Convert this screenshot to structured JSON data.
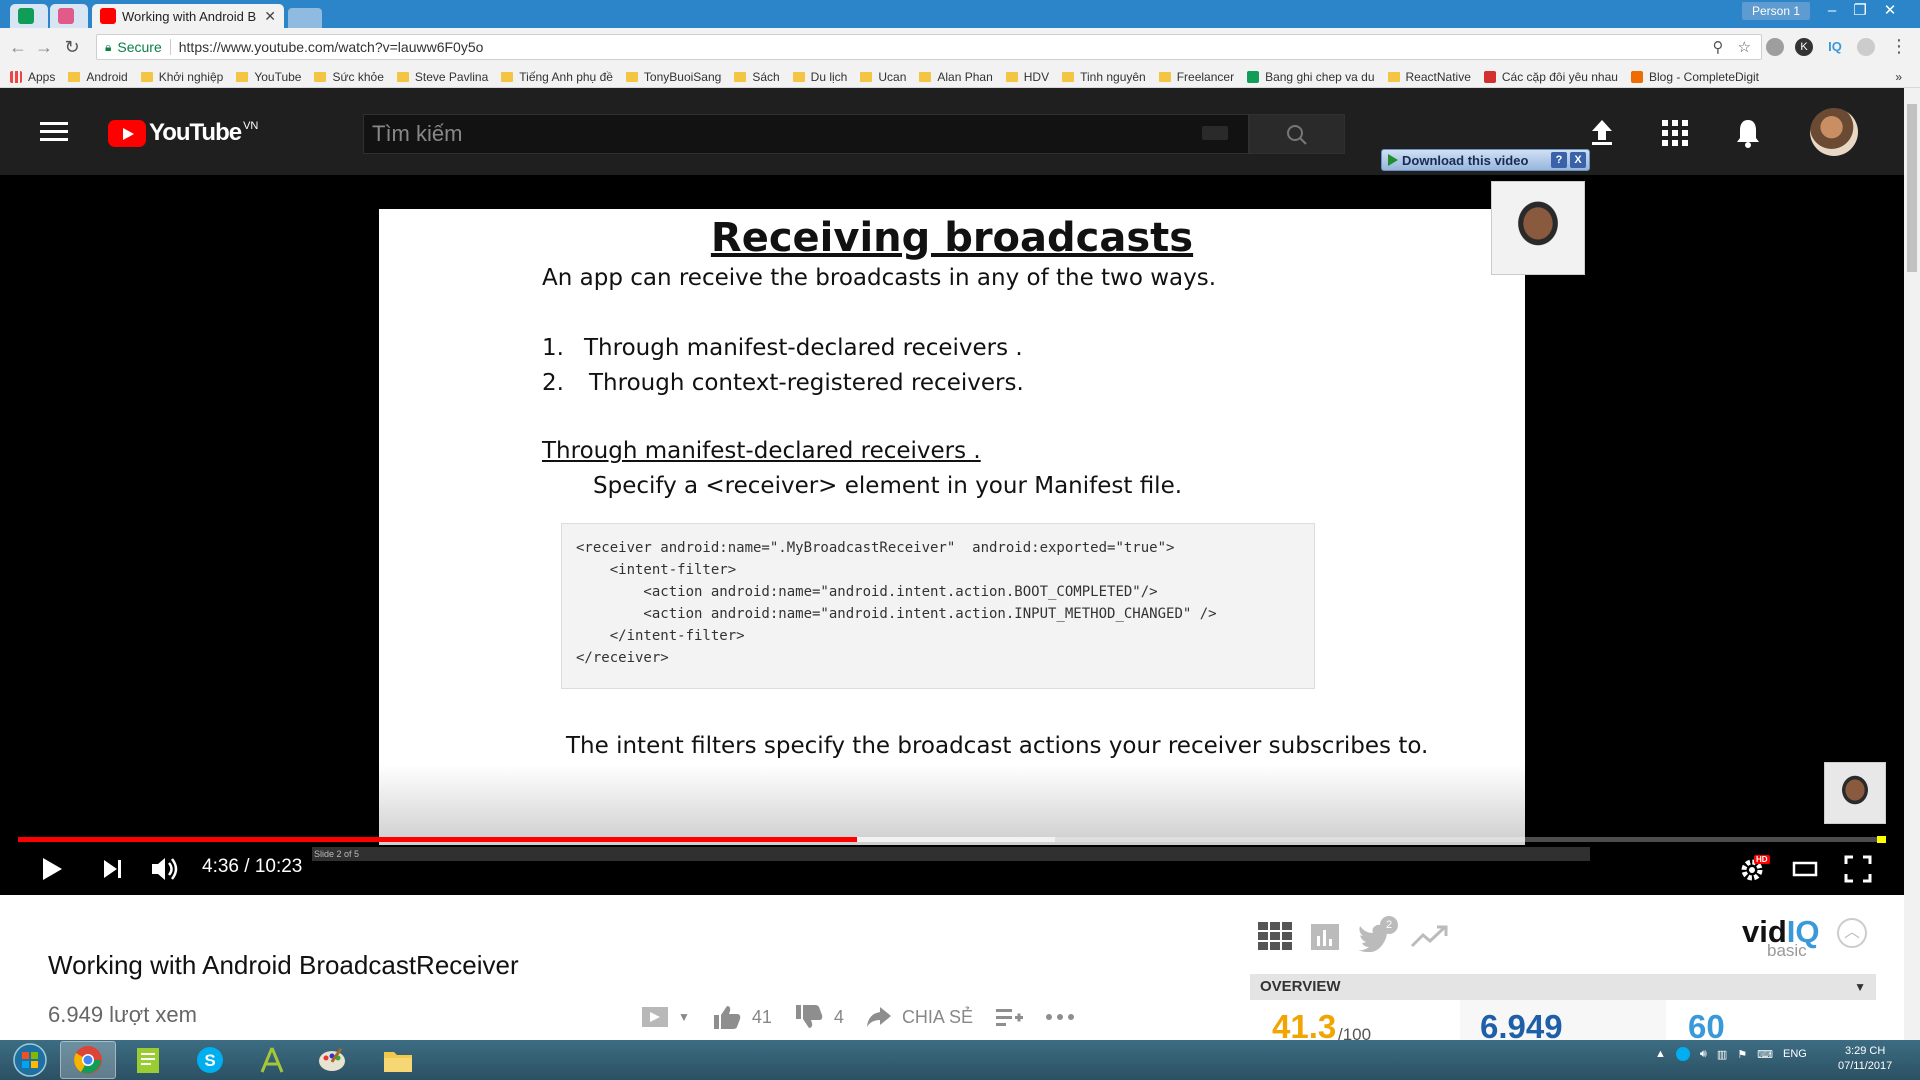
{
  "browser": {
    "tabs": [
      {
        "label": "",
        "icon": "sheets-icon",
        "color": "#0f9d58"
      },
      {
        "label": "",
        "icon": "ex-icon",
        "color": "#e05a8a"
      },
      {
        "label": "Working with Android B",
        "icon": "youtube-icon",
        "color": "#ff0000",
        "active": true
      }
    ],
    "profile": "Person 1",
    "secure_label": "Secure",
    "url": "https://www.youtube.com/watch?v=lauww6F0y5o",
    "bookmarks": [
      {
        "label": "Apps",
        "type": "apps"
      },
      {
        "label": "Android",
        "type": "folder"
      },
      {
        "label": "Khởi nghiệp",
        "type": "folder"
      },
      {
        "label": "YouTube",
        "type": "folder"
      },
      {
        "label": "Sức khỏe",
        "type": "folder"
      },
      {
        "label": "Steve Pavlina",
        "type": "folder"
      },
      {
        "label": "Tiếng Anh phụ đề",
        "type": "folder"
      },
      {
        "label": "TonyBuoiSang",
        "type": "folder"
      },
      {
        "label": "Sách",
        "type": "folder"
      },
      {
        "label": "Du lịch",
        "type": "folder"
      },
      {
        "label": "Ucan",
        "type": "folder"
      },
      {
        "label": "Alan Phan",
        "type": "folder"
      },
      {
        "label": "HDV",
        "type": "folder"
      },
      {
        "label": "Tinh nguyên",
        "type": "folder"
      },
      {
        "label": "Freelancer",
        "type": "folder"
      },
      {
        "label": "Bang ghi chep va du",
        "type": "sheets"
      },
      {
        "label": "ReactNative",
        "type": "folder"
      },
      {
        "label": "Các cặp đôi yêu nhau",
        "type": "red"
      },
      {
        "label": "Blog - CompleteDigit",
        "type": "orange"
      }
    ],
    "bookmarks_more": "»"
  },
  "youtube": {
    "logo_text": "YouTube",
    "region": "VN",
    "search_placeholder": "Tìm kiếm",
    "download_label": "Download this video",
    "download_help": "?",
    "download_close": "X"
  },
  "slide": {
    "title": "Receiving broadcasts",
    "intro": "An app can receive the broadcasts in any of the two ways.",
    "item1_num": "1.",
    "item1": "Through manifest-declared receivers .",
    "item2_num": "2.",
    "item2": "Through context-registered receivers.",
    "section_heading": "Through manifest-declared receivers .",
    "section_text": "Specify a <receiver> element in your Manifest file.",
    "code": [
      "<receiver android:name=\".MyBroadcastReceiver\"  android:exported=\"true\">",
      "    <intent-filter>",
      "        <action android:name=\"android.intent.action.BOOT_COMPLETED\"/>",
      "        <action android:name=\"android.intent.action.INPUT_METHOD_CHANGED\" />",
      "    </intent-filter>",
      "</receiver>"
    ],
    "footer": "The intent filters specify the broadcast actions your receiver subscribes to.",
    "slide_counter": "Slide 2 of 5"
  },
  "player": {
    "time": "4:36 / 10:23",
    "progress": 0.449,
    "buffered": 0.555,
    "hd_badge": "HD"
  },
  "video": {
    "title": "Working with Android BroadcastReceiver",
    "views": "6.949 lượt xem",
    "likes": "41",
    "dislikes": "4",
    "share_label": "CHIA SẺ"
  },
  "vidiq": {
    "logo_vid": "vid",
    "logo_iq": "IQ",
    "plan": "basic",
    "twitter_count": "2",
    "overview_label": "OVERVIEW",
    "score": "41.3",
    "score_max": "/100",
    "views_stat": "6.949",
    "third_stat": "60",
    "colors": {
      "score": "#f0a500",
      "views": "#1f5fa8",
      "third": "#3a9ad9"
    }
  },
  "taskbar": {
    "apps": [
      "windows-start",
      "chrome",
      "notepad",
      "skype",
      "android-studio",
      "paint",
      "file-explorer"
    ],
    "lang": "ENG",
    "time": "3:29 CH",
    "date": "07/11/2017"
  }
}
